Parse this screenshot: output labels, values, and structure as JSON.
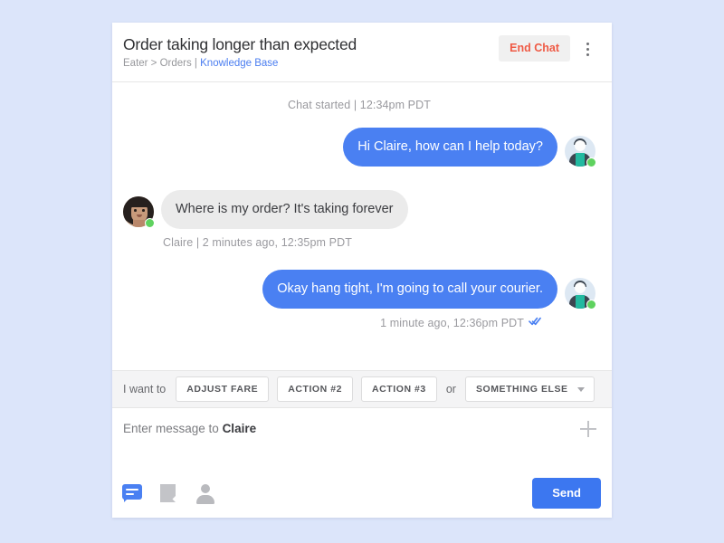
{
  "header": {
    "title": "Order taking longer than expected",
    "breadcrumb_prefix": "Eater > Orders | ",
    "breadcrumb_link": "Knowledge Base",
    "end_chat_label": "End Chat",
    "kebab_icon": "more-vertical-icon"
  },
  "conversation": {
    "system_line": "Chat started  |  12:34pm PDT",
    "messages": [
      {
        "direction": "out",
        "text": "Hi Claire, how can I help today?",
        "avatar": "agent-avatar",
        "meta": ""
      },
      {
        "direction": "in",
        "text": "Where is my order? It's taking forever",
        "avatar": "client-avatar",
        "meta": "Claire  |  2 minutes ago, 12:35pm PDT"
      },
      {
        "direction": "out",
        "text": "Okay hang tight, I'm going to call your courier.",
        "avatar": "agent-avatar",
        "meta": "1 minute ago, 12:36pm PDT",
        "read_receipt": "double-chevron-read-icon"
      }
    ]
  },
  "actionbar": {
    "prefix_label": "I want to",
    "buttons": [
      "ADJUST FARE",
      "ACTION #2",
      "ACTION #3"
    ],
    "or_label": "or",
    "dropdown_label": "SOMETHING ELSE"
  },
  "composer": {
    "placeholder_prefix": "Enter message to ",
    "placeholder_name": "Claire",
    "add_icon": "plus-icon"
  },
  "footer": {
    "icons": [
      "chat-bubble-icon",
      "note-icon",
      "person-icon"
    ],
    "send_label": "Send"
  },
  "colors": {
    "page_background": "#dce5fa",
    "bubble_out": "#4a80f2",
    "bubble_in": "#ebebeb",
    "accent_link": "#4a7df0",
    "end_chat_text": "#ef5a45",
    "send_button": "#3c77f0",
    "online_dot": "#5fd25f"
  }
}
